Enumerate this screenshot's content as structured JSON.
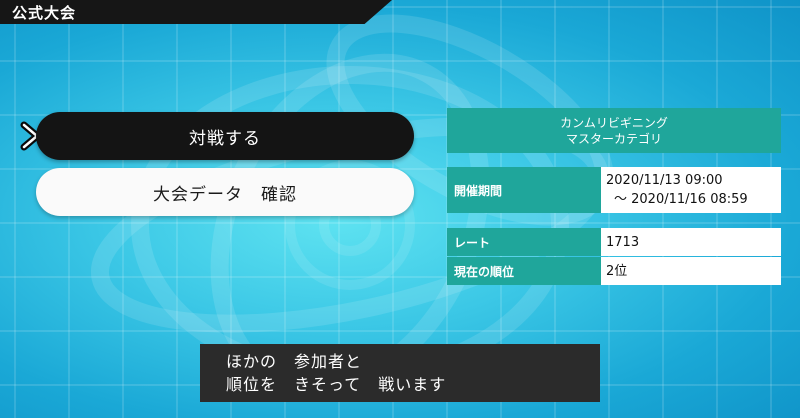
{
  "header": {
    "title": "公式大会"
  },
  "menu": {
    "items": [
      {
        "label": "対戦する",
        "selected": true
      },
      {
        "label": "大会データ　確認",
        "selected": false
      }
    ]
  },
  "info": {
    "competition_line1": "カンムリビギニング",
    "competition_line2": "マスターカテゴリ",
    "period_label": "開催期間",
    "period_start": "2020/11/13 09:00",
    "period_end": "～ 2020/11/16 08:59",
    "rate_label": "レート",
    "rate_value": "1713",
    "rank_label": "現在の順位",
    "rank_value": "2位"
  },
  "message": {
    "line1": "ほかの　参加者と",
    "line2": "順位を　きそって　戦います"
  },
  "icons": {
    "cursor": "menu-cursor-arrow-icon"
  },
  "colors": {
    "panel_teal": "#1fa69b",
    "selected_bg": "#141414",
    "background_cyan": "#3cc8e6"
  }
}
